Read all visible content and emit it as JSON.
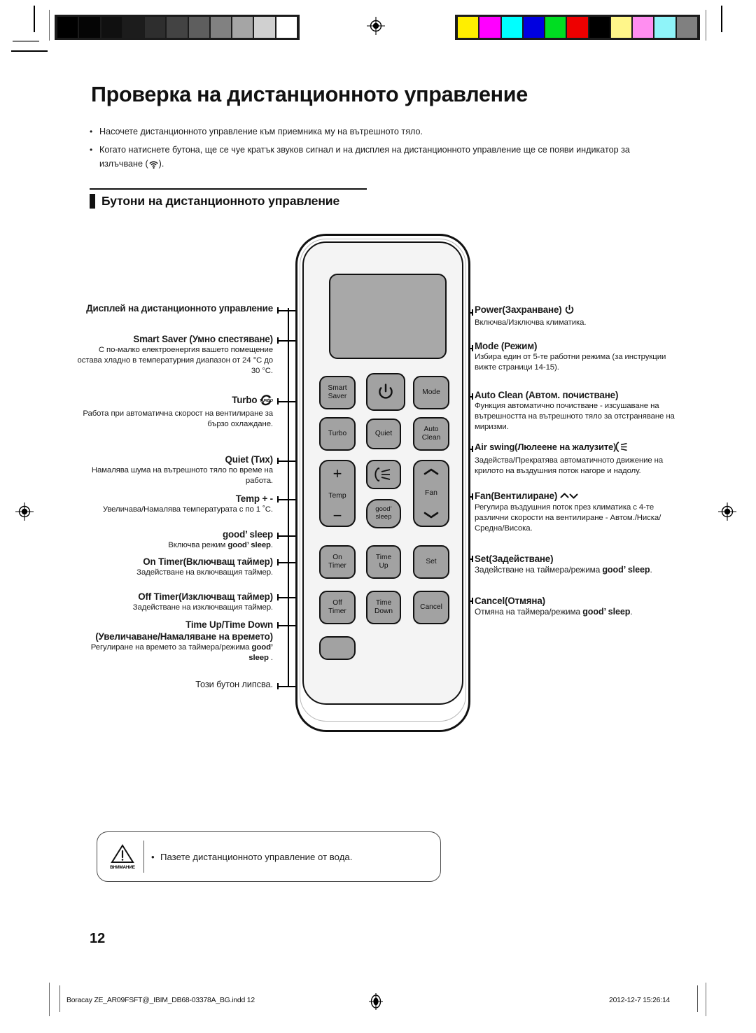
{
  "page": {
    "title": "Проверка на дистанционното управление",
    "number": "12",
    "bullets": [
      "Насочете дистанционното управление към приемника му на вътрешното тяло.",
      "Когато натиснете бутона, ще се чуе кратък звуков сигнал и на дисплея на дистанционното управление ще се появи индикатор за излъчване ( )."
    ],
    "section_heading": "Бутони на дистанционното управление"
  },
  "left_annotations": [
    {
      "title": "Дисплей на дистанционното управление",
      "desc": ""
    },
    {
      "title": "Smart Saver (Умно спестяване)",
      "desc": "С по-малко електроенергия вашето помещение остава хладно в температурния диапазон от 24 °C до 30 °C."
    },
    {
      "title": "Turbo",
      "title_icon": "turbo-icon",
      "desc": "Работа при автоматична скорост на вентилиране за бързо охлаждане."
    },
    {
      "title": "Quiet (Тих)",
      "desc": "Намалява шума на вътрешното тяло по време на работа."
    },
    {
      "title": "Temp + -",
      "desc": "Увеличава/Намалява температурата с по 1 ˚C."
    },
    {
      "title": "good’ sleep",
      "desc": "Включва режим good’ sleep."
    },
    {
      "title": "On Timer(Включващ таймер)",
      "desc": "Задействане на включващия таймер."
    },
    {
      "title": "Off Timer(Изключващ таймер)",
      "desc": "Задействане на изключващия таймер."
    },
    {
      "title": "Time Up/Time Down",
      "title2": "(Увеличаване/Намаляване на времето)",
      "desc": "Регулиране на времето за таймера/режима good’ sleep ."
    },
    {
      "title": "",
      "desc": "Този бутон липсва."
    }
  ],
  "right_annotations": [
    {
      "title": "Power(Захранване)",
      "title_icon": "power-icon",
      "desc": "Включва/Изключва климатика."
    },
    {
      "title": "Mode (Режим)",
      "desc": "Избира един от 5-те работни режима (за инструкции вижте страници 14-15)."
    },
    {
      "title": "Auto Clean (Автом. почистване)",
      "desc": "Функция автоматично почистване - изсушаване на вътрешността на вътрешното тяло за отстраняване на миризми."
    },
    {
      "title": "Air swing(Люлеене на жалузите)",
      "title_icon": "air-swing-icon",
      "desc": "Задейства/Прекратява автоматичното движение на крилото на въздушния поток нагоре и надолу."
    },
    {
      "title": "Fan(Вентилиране)",
      "title_icon": "fan-chevrons-icon",
      "desc": "Регулира въздушния поток през климатика с 4-те различни скорости на вентилиране - Автом./Ниска/Средна/Висока."
    },
    {
      "title": "Set(Задействане)",
      "desc": "Задействане на таймера/режима good’ sleep."
    },
    {
      "title": "Cancel(Отмяна)",
      "desc": "Отмяна на таймера/режима good’ sleep."
    }
  ],
  "remote": {
    "buttons": [
      {
        "name": "smart-saver",
        "label": "Smart\nSaver"
      },
      {
        "name": "power",
        "label": ""
      },
      {
        "name": "mode",
        "label": "Mode"
      },
      {
        "name": "turbo",
        "label": "Turbo"
      },
      {
        "name": "quiet",
        "label": "Quiet"
      },
      {
        "name": "auto-clean",
        "label": "Auto\nClean"
      },
      {
        "name": "temp",
        "label": "Temp"
      },
      {
        "name": "air-swing",
        "label": ""
      },
      {
        "name": "fan",
        "label": "Fan"
      },
      {
        "name": "good-sleep",
        "label": "good’\nsleep"
      },
      {
        "name": "on-timer",
        "label": "On\nTimer"
      },
      {
        "name": "time-up",
        "label": "Time\nUp"
      },
      {
        "name": "set",
        "label": "Set"
      },
      {
        "name": "off-timer",
        "label": "Off\nTimer"
      },
      {
        "name": "time-down",
        "label": "Time\nDown"
      },
      {
        "name": "cancel",
        "label": "Cancel"
      },
      {
        "name": "missing-button",
        "label": ""
      }
    ],
    "temp_plus": "+",
    "temp_minus": "−"
  },
  "caution": {
    "label": "ВНИМАНИЕ",
    "text": "Пазете дистанционното управление от вода."
  },
  "footer": {
    "file": "Boracay ZE_AR09FSFT@_IBIM_DB68-03378A_BG.indd   12",
    "date": "2012-12-7   15:26:14"
  },
  "calibration": {
    "gray_swatches": [
      "#000000",
      "#050505",
      "#101010",
      "#1c1c1c",
      "#2e2e2e",
      "#434343",
      "#5e5e5e",
      "#818181",
      "#a5a5a5",
      "#d0d0d0",
      "#ffffff"
    ],
    "color_swatches": [
      "#ffee00",
      "#ff00ff",
      "#00ffff",
      "#0000e0",
      "#00dd22",
      "#ee0000",
      "#000000",
      "#fff68a",
      "#ff8ef0",
      "#8ff4f9",
      "#808080"
    ]
  }
}
